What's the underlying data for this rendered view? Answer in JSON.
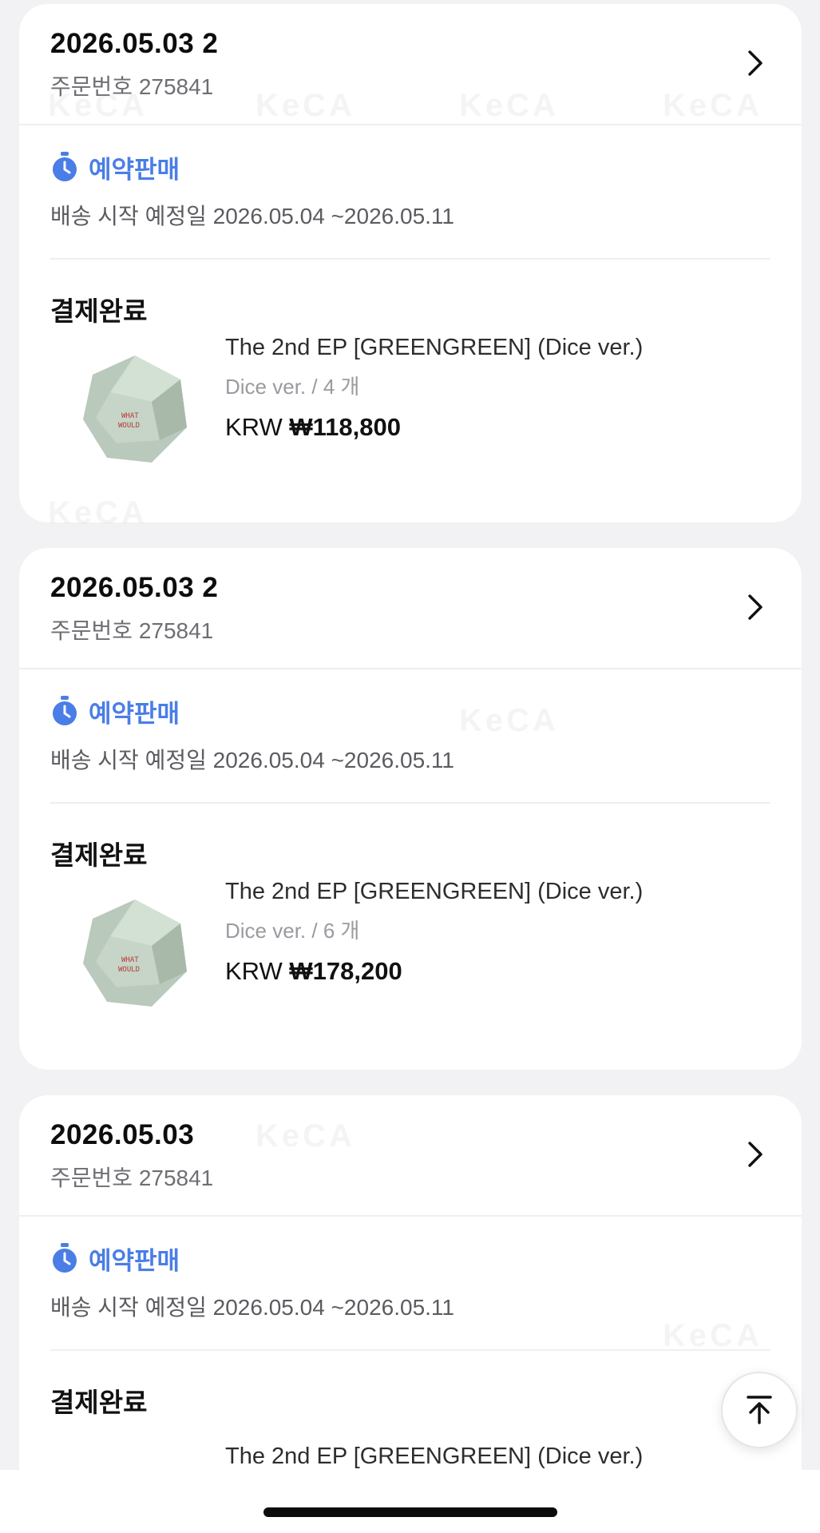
{
  "orders": [
    {
      "date": "2026.05.03 2",
      "order_number": "주문번호 275841",
      "presale_label": "예약판매",
      "ship_date": "배송 시작 예정일 2026.05.04 ~2026.05.11",
      "status": "결제완료",
      "product": {
        "name": "The 2nd EP [GREENGREEN] (Dice ver.)",
        "option": "Dice ver. / 4 개",
        "currency": "KRW",
        "price": "₩118,800"
      }
    },
    {
      "date": "2026.05.03 2",
      "order_number": "주문번호 275841",
      "presale_label": "예약판매",
      "ship_date": "배송 시작 예정일 2026.05.04 ~2026.05.11",
      "status": "결제완료",
      "product": {
        "name": "The 2nd EP [GREENGREEN] (Dice ver.)",
        "option": "Dice ver. / 6 개",
        "currency": "KRW",
        "price": "₩178,200"
      }
    },
    {
      "date": "2026.05.03",
      "order_number": "주문번호 275841",
      "presale_label": "예약판매",
      "ship_date": "배송 시작 예정일 2026.05.04 ~2026.05.11",
      "status": "결제완료",
      "product": {
        "name": "The 2nd EP [GREENGREEN] (Dice ver.)"
      }
    }
  ],
  "colors": {
    "accent": "#4a7ee6",
    "background": "#f2f2f4",
    "card": "#ffffff"
  },
  "icons": {
    "presale": "stopwatch-icon",
    "detail": "chevron-right-icon",
    "scroll_top": "arrow-up-to-top-icon"
  }
}
